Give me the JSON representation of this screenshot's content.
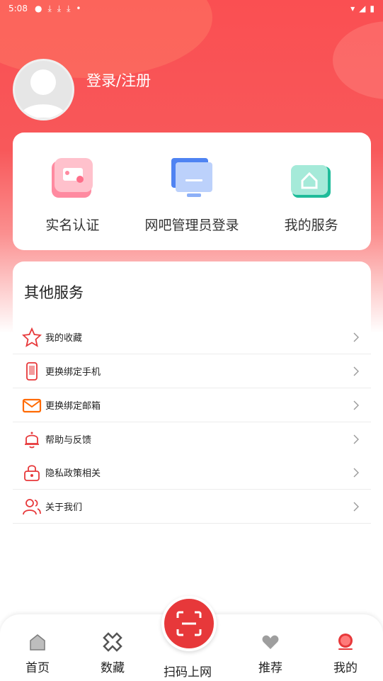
{
  "status_bar": {
    "time": "5:08"
  },
  "profile": {
    "login_label": "登录/注册"
  },
  "quick_actions": [
    {
      "label": "实名认证",
      "icon": "id-card-icon"
    },
    {
      "label": "网吧管理员登录",
      "icon": "monitor-icon"
    },
    {
      "label": "我的服务",
      "icon": "house-service-icon"
    }
  ],
  "other_services": {
    "title": "其他服务",
    "items": [
      {
        "label": "我的收藏",
        "icon": "star-icon"
      },
      {
        "label": "更换绑定手机",
        "icon": "phone-icon"
      },
      {
        "label": "更换绑定邮箱",
        "icon": "mail-icon"
      },
      {
        "label": "帮助与反馈",
        "icon": "bell-icon"
      },
      {
        "label": "隐私政策相关",
        "icon": "lock-icon"
      },
      {
        "label": "关于我们",
        "icon": "users-icon"
      }
    ]
  },
  "tabbar": {
    "home": "首页",
    "collection": "数藏",
    "scan": "扫码上网",
    "recommend": "推荐",
    "mine": "我的"
  },
  "colors": {
    "accent": "#e7383a",
    "hero": "#fa4f52"
  }
}
